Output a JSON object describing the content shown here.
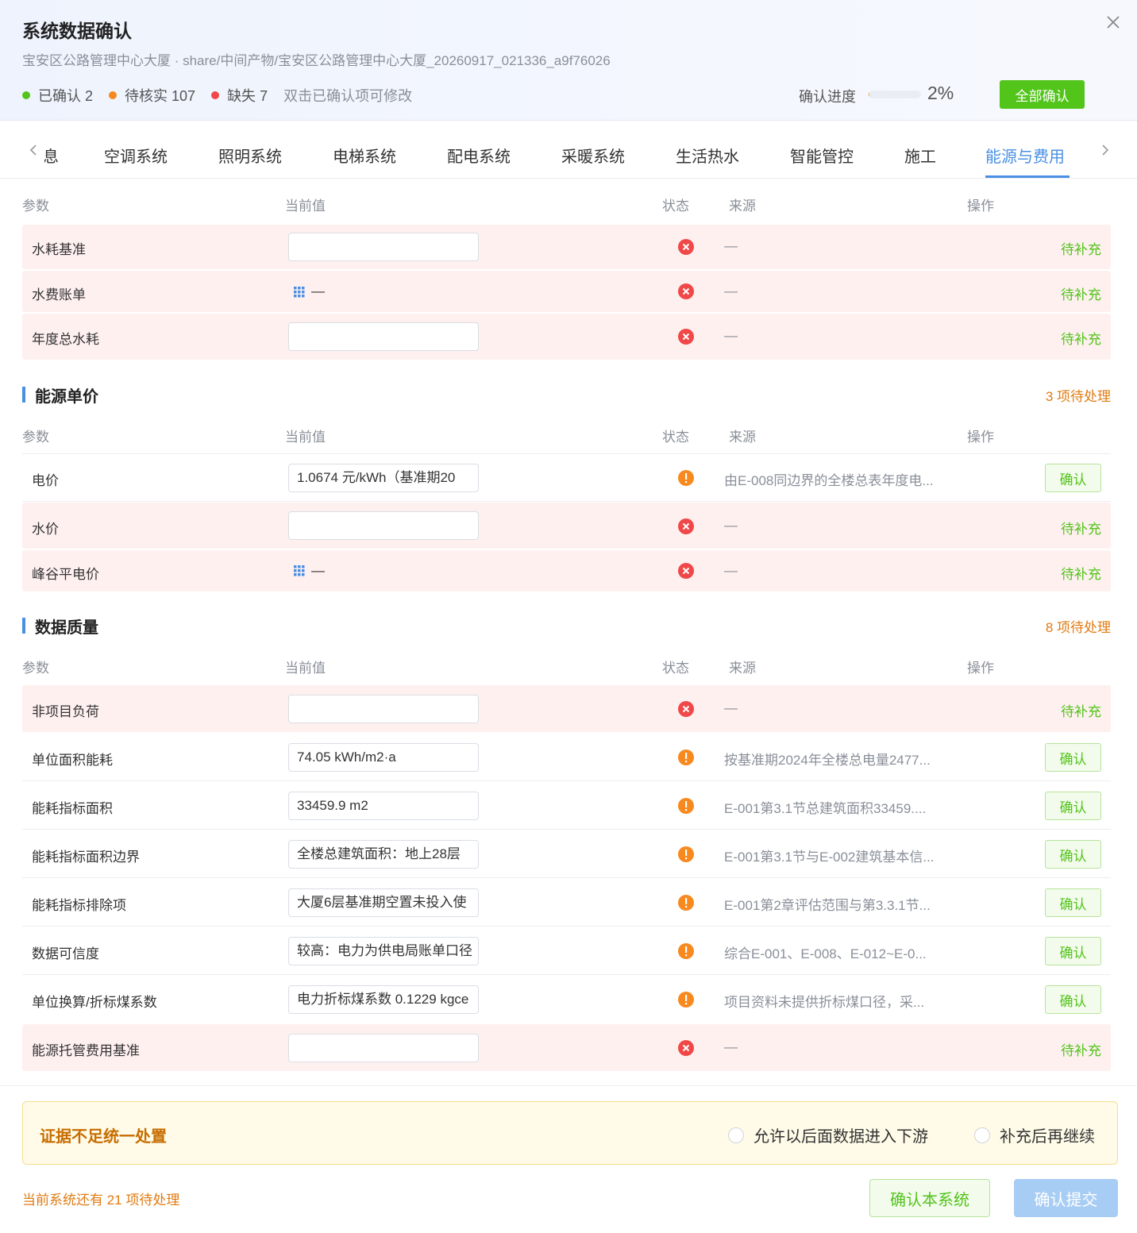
{
  "header": {
    "title": "系统数据确认",
    "subtitle": "宝安区公路管理中心大厦 · share/中间产物/宝安区公路管理中心大厦_20260917_021336_a9f76026",
    "stats": {
      "confirmed": "已确认 2",
      "pending": "待核实 107",
      "missing": "缺失 7",
      "hint": "双击已确认项可修改"
    },
    "progress_label": "确认进度",
    "progress_value": 0.02,
    "progress_pct": "2%",
    "confirm_all": "全部确认"
  },
  "colors": {
    "green": "#52c41a",
    "orange": "#f7891f",
    "red": "#f04848",
    "blue": "#4a90e2"
  },
  "tabs": {
    "partial": "信息",
    "items": [
      "空调系统",
      "照明系统",
      "电梯系统",
      "配电系统",
      "采暖系统",
      "生活热水",
      "智能管控",
      "施工",
      "能源与费用"
    ],
    "active": "能源与费用"
  },
  "columns": {
    "param": "参数",
    "value": "当前值",
    "status": "状态",
    "source": "来源",
    "action": "操作"
  },
  "actions": {
    "supplement": "待补充",
    "confirm": "确认"
  },
  "dash": "—",
  "group_water": {
    "rows": [
      {
        "name": "水耗基准",
        "value": "",
        "source": "—"
      },
      {
        "name": "水费账单",
        "value": "—",
        "source": "—"
      },
      {
        "name": "年度总水耗",
        "value": "",
        "source": "—"
      }
    ]
  },
  "group_price": {
    "title": "能源单价",
    "count": "3 项待处理",
    "rows": [
      {
        "name": "电价",
        "value": "1.0674 元/kWh（基准期20",
        "source": "由E-008同边界的全楼总表年度电..."
      },
      {
        "name": "水价",
        "value": "",
        "source": "—"
      },
      {
        "name": "峰谷平电价",
        "value": "—",
        "source": "—"
      }
    ]
  },
  "group_quality": {
    "title": "数据质量",
    "count": "8 项待处理",
    "rows": [
      {
        "name": "非项目负荷",
        "value": "",
        "source": "—"
      },
      {
        "name": "单位面积能耗",
        "value": "74.05 kWh/m2·a",
        "source": "按基准期2024年全楼总电量2477..."
      },
      {
        "name": "能耗指标面积",
        "value": "33459.9 m2",
        "source": "E-001第3.1节总建筑面积33459...."
      },
      {
        "name": "能耗指标面积边界",
        "value": "全楼总建筑面积：地上28层",
        "source": "E-001第3.1节与E-002建筑基本信..."
      },
      {
        "name": "能耗指标排除项",
        "value": "大厦6层基准期空置未投入使",
        "source": "E-001第2章评估范围与第3.3.1节..."
      },
      {
        "name": "数据可信度",
        "value": "较高：电力为供电局账单口径",
        "source": "综合E-001、E-008、E-012~E-0..."
      },
      {
        "name": "单位换算/折标煤系数",
        "value": "电力折标煤系数 0.1229 kgce",
        "source": "项目资料未提供折标煤口径，采..."
      },
      {
        "name": "能源托管费用基准",
        "value": "",
        "source": "—"
      }
    ]
  },
  "footer": {
    "evidence_title": "证据不足统一处置",
    "option_allow": "允许以后面数据进入下游",
    "option_supplement": "补充后再继续",
    "pending_note": "当前系统还有 21 项待处理",
    "confirm_system": "确认本系统",
    "confirm_submit": "确认提交"
  }
}
